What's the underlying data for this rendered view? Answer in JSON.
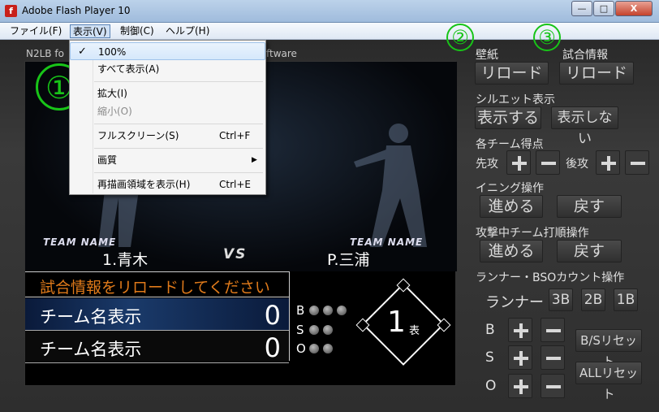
{
  "window": {
    "title": "Adobe Flash Player 10",
    "min_glyph": "—",
    "max_glyph": "□",
    "close_glyph": "X"
  },
  "menubar": {
    "items": [
      "ファイル(F)",
      "表示(V)",
      "制御(C)",
      "ヘルプ(H)"
    ]
  },
  "view_menu": {
    "items": [
      {
        "label": "100%",
        "checked": "✓",
        "shortcut": ""
      },
      {
        "label": "すべて表示(A)",
        "shortcut": ""
      },
      {
        "label": "拡大(I)",
        "shortcut": ""
      },
      {
        "label": "縮小(O)",
        "shortcut": ""
      },
      {
        "label": "フルスクリーン(S)",
        "shortcut": "Ctrl+F"
      },
      {
        "label": "画質",
        "shortcut": "",
        "submenu_arrow": "▶"
      },
      {
        "label": "再描画領域を表示(H)",
        "shortcut": "Ctrl+E"
      }
    ]
  },
  "credit": {
    "head": "N2LB fo",
    "tail": "ftware"
  },
  "scoreboard": {
    "team_label_left": "TEAM NAME",
    "team_label_right": "TEAM NAME",
    "batter": "1.青木",
    "vs": "VS",
    "pitcher": "P.三浦",
    "message": "試合情報をリロードしてください",
    "rows": [
      {
        "team": "チーム名表示",
        "score": "0"
      },
      {
        "team": "チーム名表示",
        "score": "0"
      }
    ],
    "bso_labels": [
      "B",
      "S",
      "O"
    ],
    "inning": "1",
    "half": "表"
  },
  "annotations": {
    "one": "①",
    "two": "②",
    "three": "③"
  },
  "panel": {
    "wallpaper_label": "壁紙",
    "wallpaper_btn": "リロード",
    "gameinfo_label": "試合情報",
    "gameinfo_btn": "リロード",
    "silhouette_label": "シルエット表示",
    "silhouette_show": "表示する",
    "silhouette_hide": "表示しない",
    "team_score_label": "各チーム得点",
    "first_label": "先攻",
    "second_label": "後攻",
    "inning_label": "イニング操作",
    "advance": "進める",
    "back": "戻す",
    "batting_label": "攻撃中チーム打順操作",
    "runner_bso_label": "ランナー・BSOカウント操作",
    "runner_label": "ランナー",
    "bases": [
      "3B",
      "2B",
      "1B"
    ],
    "b_label": "B",
    "s_label": "S",
    "o_label": "O",
    "bs_reset": "B/Sリセット",
    "all_reset": "ALLリセット"
  }
}
